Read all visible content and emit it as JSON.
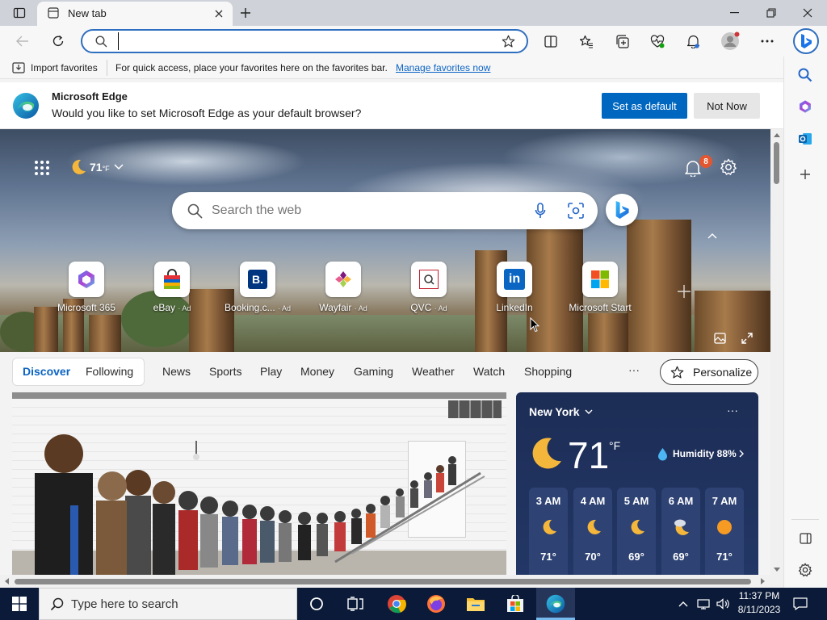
{
  "browser": {
    "tab_title": "New tab",
    "address_value": "",
    "profile_badge_color": "#d13438"
  },
  "favorites_bar": {
    "import_label": "Import favorites",
    "hint": "For quick access, place your favorites here on the favorites bar.",
    "manage_link": "Manage favorites now"
  },
  "default_banner": {
    "title": "Microsoft Edge",
    "message": "Would you like to set Microsoft Edge as your default browser?",
    "set_default": "Set as default",
    "not_now": "Not Now"
  },
  "hero": {
    "temperature": "71",
    "temp_unit": "°F",
    "notification_count": "8",
    "search_placeholder": "Search the web",
    "quick_links": [
      {
        "label": "Microsoft 365",
        "ad": ""
      },
      {
        "label": "eBay",
        "ad": "· Ad"
      },
      {
        "label": "Booking.c...",
        "ad": "· Ad"
      },
      {
        "label": "Wayfair",
        "ad": "· Ad"
      },
      {
        "label": "QVC",
        "ad": "· Ad"
      },
      {
        "label": "LinkedIn",
        "ad": ""
      },
      {
        "label": "Microsoft Start",
        "ad": ""
      }
    ]
  },
  "feed_nav": {
    "pills": [
      "Discover",
      "Following"
    ],
    "items": [
      "News",
      "Sports",
      "Play",
      "Money",
      "Gaming",
      "Weather",
      "Watch",
      "Shopping"
    ],
    "more": "···",
    "personalize": "Personalize"
  },
  "weather_card": {
    "city": "New York",
    "temp": "71",
    "unit": "°F",
    "humidity": "Humidity 88%",
    "more": "···",
    "hours": [
      {
        "time": "3 AM",
        "temp": "71°"
      },
      {
        "time": "4 AM",
        "temp": "70°"
      },
      {
        "time": "5 AM",
        "temp": "69°"
      },
      {
        "time": "6 AM",
        "temp": "69°"
      },
      {
        "time": "7 AM",
        "temp": "71°"
      }
    ]
  },
  "taskbar": {
    "search_placeholder": "Type here to search",
    "time": "11:37 PM",
    "date": "8/11/2023"
  }
}
